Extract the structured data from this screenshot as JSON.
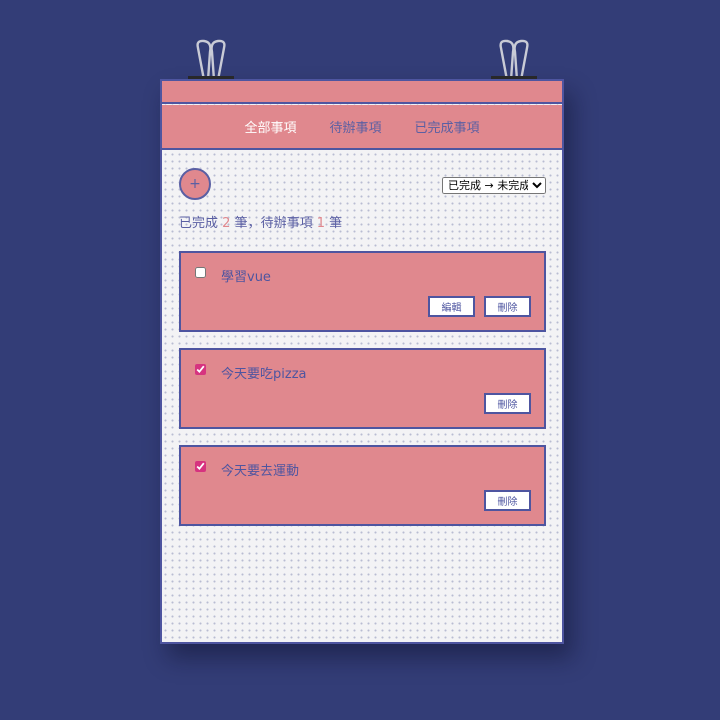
{
  "tabs": [
    {
      "label": "全部事項",
      "active": true
    },
    {
      "label": "待辦事項",
      "active": false
    },
    {
      "label": "已完成事項",
      "active": false
    }
  ],
  "add_button": {
    "label": "+"
  },
  "sort": {
    "selected": "已完成 → 未完成"
  },
  "summary": {
    "done_prefix": "已完成",
    "done_count": "2",
    "mid": "筆，待辦事項",
    "pending_count": "1",
    "suffix": "筆"
  },
  "todos": [
    {
      "title": "學習vue",
      "checked": false,
      "edit_label": "編輯",
      "delete_label": "刪除"
    },
    {
      "title": "今天要吃pizza",
      "checked": true,
      "delete_label": "刪除"
    },
    {
      "title": "今天要去運動",
      "checked": true,
      "delete_label": "刪除"
    }
  ],
  "colors": {
    "background": "#333d77",
    "accent": "#e0888e",
    "border": "#4e55a0",
    "paper": "#f3f3f5",
    "active_tab": "#ffffff",
    "checkbox": "#d6337f"
  },
  "icons": [
    "binder-clip-icon",
    "binder-clip-icon"
  ]
}
